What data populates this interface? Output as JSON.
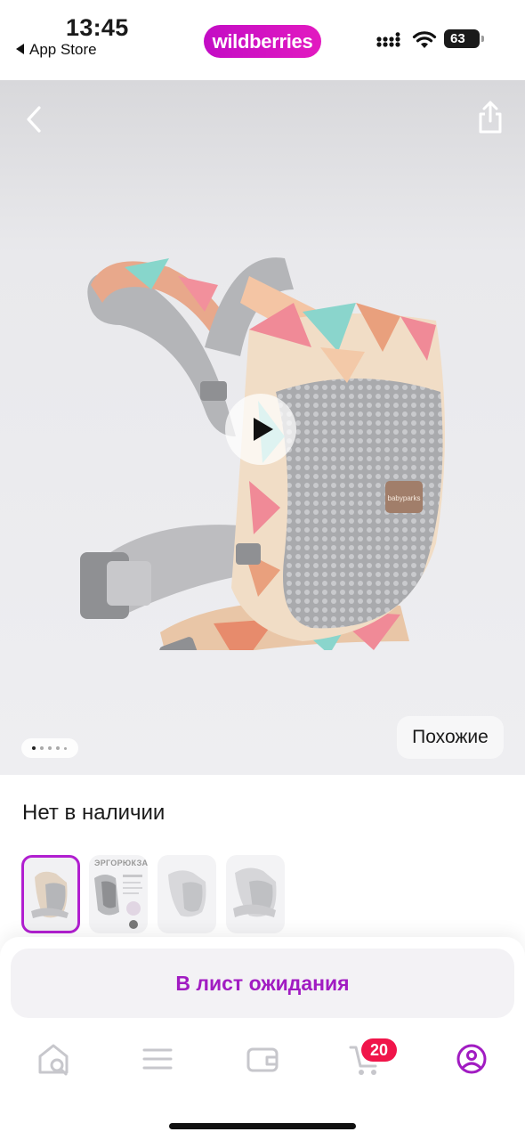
{
  "status_bar": {
    "time": "13:45",
    "back_app": "App Store",
    "battery": "63"
  },
  "brand": {
    "name": "wildberries",
    "color": "#cb11c4"
  },
  "hero": {
    "product_logo_text": "babyparks",
    "pagination": {
      "pages": 5,
      "current": 1
    },
    "similar_label": "Похожие"
  },
  "product": {
    "availability": "Нет в наличии",
    "thumbnails": [
      {
        "caption": "",
        "selected": true
      },
      {
        "caption": "ЭРГОРЮКЗАК",
        "selected": false
      },
      {
        "caption": "",
        "selected": false
      },
      {
        "caption": "",
        "selected": false
      }
    ]
  },
  "actions": {
    "waitlist_label": "В лист ожидания"
  },
  "tabbar": {
    "items": [
      {
        "icon": "home-search-icon",
        "active": false
      },
      {
        "icon": "catalog-menu-icon",
        "active": false
      },
      {
        "icon": "wallet-icon",
        "active": false
      },
      {
        "icon": "cart-icon",
        "active": false
      },
      {
        "icon": "profile-icon",
        "active": true
      }
    ],
    "cart_badge": "20"
  },
  "colors": {
    "accent": "#a11cc2",
    "badge": "#f0154a",
    "inactive_icon": "#c7c7cc"
  }
}
